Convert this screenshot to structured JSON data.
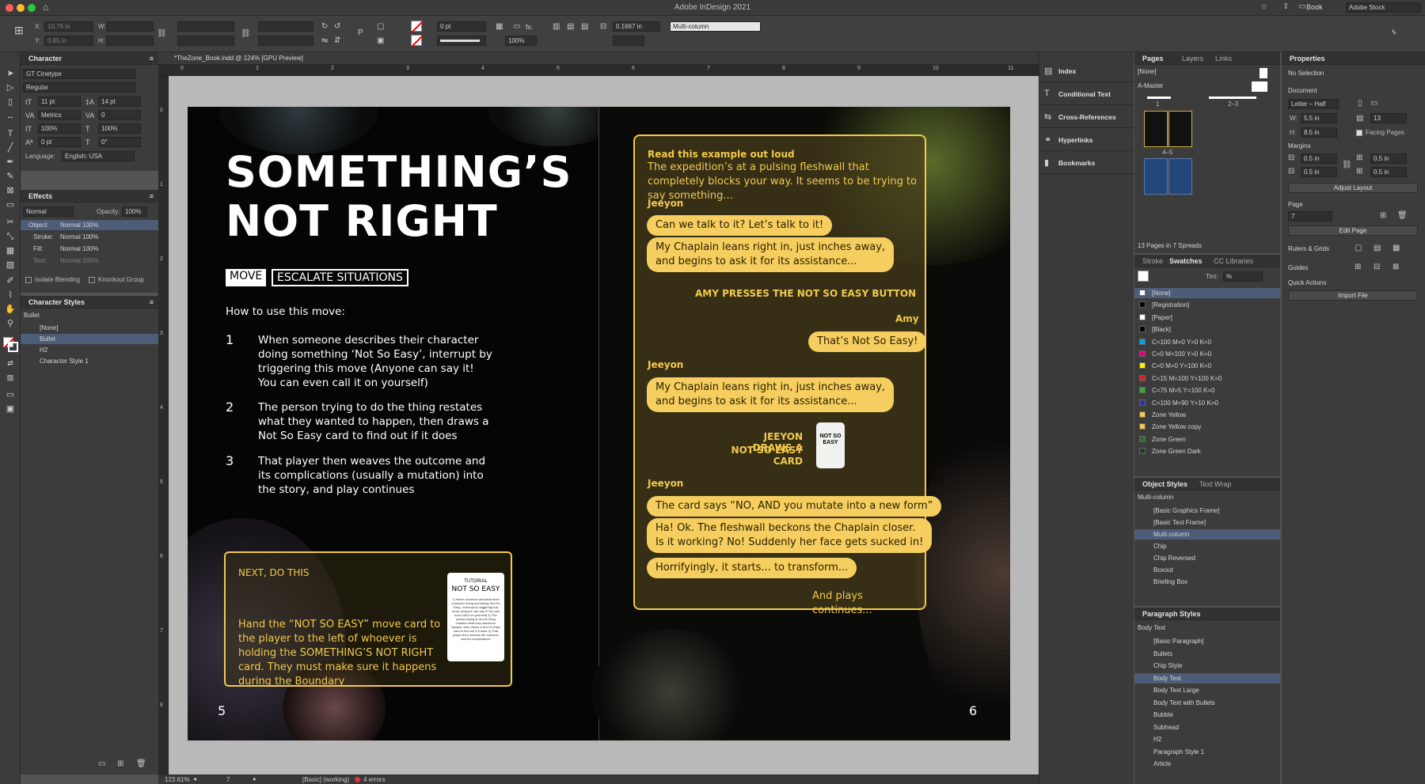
{
  "app_title": "Adobe InDesign 2021",
  "workspace": "Book",
  "stock_search_placeholder": "Adobe Stock",
  "control": {
    "x_label": "X:",
    "x_value": "10.76 in",
    "y_label": "Y:",
    "y_value": "0.85 in",
    "w_label": "W:",
    "h_label": "H:",
    "stroke_weight": "0 pt",
    "scale": "100%",
    "fx": "fx.",
    "gutter": "0.1667 in",
    "style_value": "Multi-column"
  },
  "character_panel": {
    "title": "Character",
    "font": "GT Cinetype",
    "style": "Regular",
    "size": "11 pt",
    "leading": "14 pt",
    "kerning": "Metrics",
    "tracking": "0",
    "vscale": "100%",
    "hscale": "100%",
    "baseline": "0 pt",
    "skew": "0°",
    "language_label": "Language:",
    "language": "English: USA"
  },
  "effects_panel": {
    "title": "Effects",
    "blend": "Normal",
    "opacity_label": "Opacity:",
    "opacity": "100%",
    "rows": [
      {
        "label": "Object:",
        "value": "Normal 100%"
      },
      {
        "label": "Stroke:",
        "value": "Normal 100%"
      },
      {
        "label": "Fill:",
        "value": "Normal 100%"
      },
      {
        "label": "Text:",
        "value": "Normal 100%"
      }
    ],
    "isolate": "Isolate Blending",
    "knockout": "Knockout Group"
  },
  "char_styles_panel": {
    "title": "Character Styles",
    "current": "Bullet",
    "items": [
      "[None]",
      "Bullet",
      "H2",
      "Character Style 1"
    ]
  },
  "doc_tab": "*TheZone_Book.indd @ 124% [GPU Preview]",
  "ruler_marks": [
    "0",
    "1",
    "2",
    "3",
    "4",
    "5",
    "6",
    "7",
    "8",
    "9",
    "10",
    "11"
  ],
  "vruler_marks": [
    "0",
    "1",
    "2",
    "3",
    "4",
    "5",
    "6",
    "7",
    "8"
  ],
  "status": {
    "zoom": "123.61%",
    "page": "7",
    "style": "[Basic] (working)",
    "errors": "4 errors"
  },
  "left_page": {
    "headline_1": "SOMETHING’S",
    "headline_2": "NOT RIGHT",
    "chip_1": "MOVE",
    "chip_2": "ESCALATE SITUATIONS",
    "intro": "How to use this move:",
    "steps": [
      {
        "num": "1",
        "text": "When someone describes their character doing something ‘Not So Easy’, interrupt by triggering this move (Anyone can say it! You can even call it on yourself)"
      },
      {
        "num": "2",
        "text": "The person trying to do the thing restates what they wanted to happen, then draws a Not So Easy card to find out if it does"
      },
      {
        "num": "3",
        "text": "That player then weaves the outcome and its com­plications (usually a mutation) into the story, and play continues"
      }
    ],
    "box_heading": "NEXT, DO THIS",
    "box_text": "Hand the “NOT SO EASY” move card to the player to the left of whoever is holding the SOMETHING’S NOT RIGHT card. They must make sure it happens during the Boundary",
    "card_label": "TUTORIAL",
    "card_title": "NOT SO EASY",
    "card_body": "1) When someone describes their character doing something 'Not So Easy', interrupt by triggering this move (Anyone can say it! You can even call it on yourself) 2) The person trying to do the thing restates what they wanted to happen, then draws a Not So Easy card to find out if it does 3) That player then weaves the outcome and its complications",
    "page_number": "5"
  },
  "right_page": {
    "read_heading": "Read this example out loud",
    "read_text": "The expedition’s at a pulsing fleshwall that completely blocks your way. It seems to be trying to say something...",
    "speaker_1": "Jeeyon",
    "bubble_1": "Can we talk to it? Let’s talk to it!",
    "bubble_2a": "My Chaplain leans right in, just inches away,",
    "bubble_2b": "and begins to ask it for its assistance...",
    "action_1": "AMY PRESSES THE NOT SO EASY BUTTON",
    "speaker_2": "Amy",
    "bubble_3": "That’s Not So Easy!",
    "speaker_3": "Jeeyon",
    "bubble_4a": "My Chaplain leans right in, just inches away,",
    "bubble_4b": "and begins to ask it for its assistance...",
    "action_2a": "JEEYON DRAWS A",
    "action_2b": "NOT SO EASY CARD",
    "mini_card": "NOT SO EASY",
    "speaker_4": "Jeeyon",
    "bubble_5": "The card says “NO, AND you mutate into a new form”",
    "bubble_6a": "Ha! Ok. The fleshwall beckons the Chaplain closer.",
    "bubble_6b": "Is it working? No! Suddenly her face gets sucked in!",
    "bubble_7": "Horrifyingly, it starts... to transform...",
    "closing": "And plays continues...",
    "page_number": "6"
  },
  "side_strip": [
    "Index",
    "Conditional Text",
    "Cross-References",
    "Hyperlinks",
    "Bookmarks"
  ],
  "pages_panel": {
    "tabs": [
      "Pages",
      "Layers",
      "Links"
    ],
    "none": "[None]",
    "master": "A-Master",
    "labels": [
      "1",
      "2–3",
      "4–5"
    ],
    "footer": "13 Pages in 7 Spreads"
  },
  "swatches_panel": {
    "tabs": [
      "Stroke",
      "Swatches",
      "CC Libraries"
    ],
    "tint_label": "Tint:",
    "tint": "%",
    "items": [
      {
        "name": "[None]",
        "color": "#ffffff"
      },
      {
        "name": "[Registration]",
        "color": "#000000"
      },
      {
        "name": "[Paper]",
        "color": "#ffffff"
      },
      {
        "name": "[Black]",
        "color": "#000000"
      },
      {
        "name": "C=100 M=0 Y=0 K=0",
        "color": "#00a4e4"
      },
      {
        "name": "C=0 M=100 Y=0 K=0",
        "color": "#e6007e"
      },
      {
        "name": "C=0 M=0 Y=100 K=0",
        "color": "#fff200"
      },
      {
        "name": "C=15 M=100 Y=100 K=0",
        "color": "#d2232a"
      },
      {
        "name": "C=75 M=5 Y=100 K=0",
        "color": "#3aa935"
      },
      {
        "name": "C=100 M=90 Y=10 K=0",
        "color": "#2e3192"
      },
      {
        "name": "Zone Yellow",
        "color": "#f2c94c"
      },
      {
        "name": "Zone Yellow copy",
        "color": "#f2c94c"
      },
      {
        "name": "Zone Green",
        "color": "#2f6b3a"
      },
      {
        "name": "Zone Green Dark",
        "color": "#1f3f25"
      }
    ]
  },
  "object_styles_panel": {
    "tabs": [
      "Object Styles",
      "Text Wrap"
    ],
    "current": "Multi-column",
    "items": [
      "[Basic Graphics Frame]",
      "[Basic Text Frame]",
      "Multi-column",
      "Chip",
      "Chip Reversed",
      "Boxout",
      "Briefing Box"
    ]
  },
  "para_styles_panel": {
    "title": "Paragraph Styles",
    "current": "Body Text",
    "items": [
      "[Basic Paragraph]",
      "Bullets",
      "Chip Style",
      "Body Text",
      "Body Text Large",
      "Body Text with Bullets",
      "Bubble",
      "Subhead",
      "H2",
      "Paragraph Style 1",
      "Article"
    ]
  },
  "properties_panel": {
    "title": "Properties",
    "selection": "No Selection",
    "document_label": "Document",
    "size": "Letter – Half",
    "w_label": "W:",
    "w": "5.5 in",
    "h_label": "H:",
    "h": "8.5 in",
    "pages": "13",
    "facing": "Facing Pages",
    "margins_label": "Margins",
    "margin": "0.5 in",
    "adjust": "Adjust Layout",
    "page_label": "Page",
    "page": "7",
    "edit_page": "Edit Page",
    "rulers": "Rulers & Grids",
    "guides": "Guides",
    "quick": "Quick Actions",
    "import": "Import File"
  }
}
